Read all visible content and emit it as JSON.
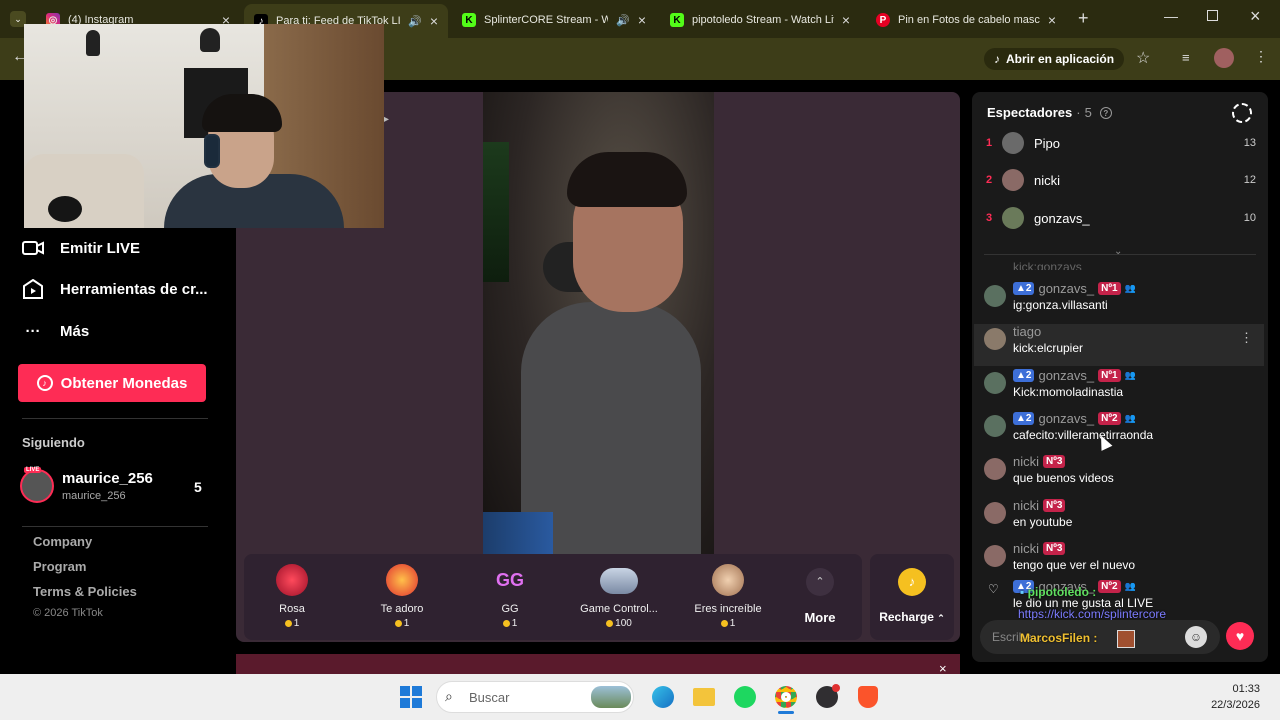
{
  "browser": {
    "tabs": [
      {
        "title": "(4) Instagram"
      },
      {
        "title": "Para ti: Feed de TikTok LIVE"
      },
      {
        "title": "SplinterCORE Stream - Watch"
      },
      {
        "title": "pipotoledo Stream - Watch Live"
      },
      {
        "title": "Pin en Fotos de cabelo masculino"
      }
    ],
    "open_app_label": "Abrir en aplicación"
  },
  "sidebar": {
    "items": [
      {
        "label": "Emitir LIVE"
      },
      {
        "label": "Herramientas de cr..."
      },
      {
        "label": "Más"
      }
    ],
    "coins_button": "Obtener Monedas",
    "following_heading": "Siguiendo",
    "following": {
      "name": "maurice_256",
      "handle": "maurice_256",
      "count": "5",
      "live_badge": "LIVE"
    },
    "footer": {
      "company": "Company",
      "program": "Program",
      "terms": "Terms & Policies",
      "copyright": "© 2026 TikTok"
    }
  },
  "gifts": [
    {
      "name": "Rosa",
      "price": "1",
      "color": "#d4223a"
    },
    {
      "name": "Te adoro",
      "price": "1",
      "color": "#f05a5a"
    },
    {
      "name": "GG",
      "price": "1",
      "color": "#c060e0"
    },
    {
      "name": "Game Control...",
      "price": "100",
      "color": "#9fb0c8"
    },
    {
      "name": "Eres increíble",
      "price": "1",
      "color": "#d8b090"
    }
  ],
  "gift_more_label": "More",
  "recharge_label": "Recharge",
  "viewers_panel": {
    "title": "Espectadores",
    "count": "5",
    "top": [
      {
        "rank": "1",
        "name": "Pipo",
        "score": "13"
      },
      {
        "rank": "2",
        "name": "nicki",
        "score": "12"
      },
      {
        "rank": "3",
        "name": "gonzavs_",
        "score": "10"
      }
    ]
  },
  "chat": {
    "partial_top": "kick:gonzavs",
    "messages": [
      {
        "user": "gonzavs_",
        "level": "2",
        "rank": "Nº1",
        "text": "ig:gonza.villasanti"
      },
      {
        "user": "tiago",
        "level": "",
        "rank": "",
        "text": "kick:elcrupier"
      },
      {
        "user": "gonzavs_",
        "level": "2",
        "rank": "Nº1",
        "text": "Kick:momoladinastia"
      },
      {
        "user": "gonzavs_",
        "level": "2",
        "rank": "Nº2",
        "text": "cafecito:villerametirraonda"
      },
      {
        "user": "nicki",
        "level": "",
        "rank": "Nº3",
        "text": "que buenos videos"
      },
      {
        "user": "nicki",
        "level": "",
        "rank": "Nº3",
        "text": "en youtube"
      },
      {
        "user": "nicki",
        "level": "",
        "rank": "Nº3",
        "text": "tengo que ver el nuevo"
      },
      {
        "user": "gonzavs_",
        "level": "2",
        "rank": "Nº2",
        "text": "le dio un me gusta al LIVE"
      }
    ],
    "input_placeholder": "Escribe...",
    "overlay": {
      "user1": "pipotoledo :",
      "link": "https://kick.com/splintercore",
      "user2": "MarcosFilen :"
    }
  },
  "taskbar": {
    "search_placeholder": "Buscar",
    "time": "01:33",
    "date": "22/3/2026"
  }
}
